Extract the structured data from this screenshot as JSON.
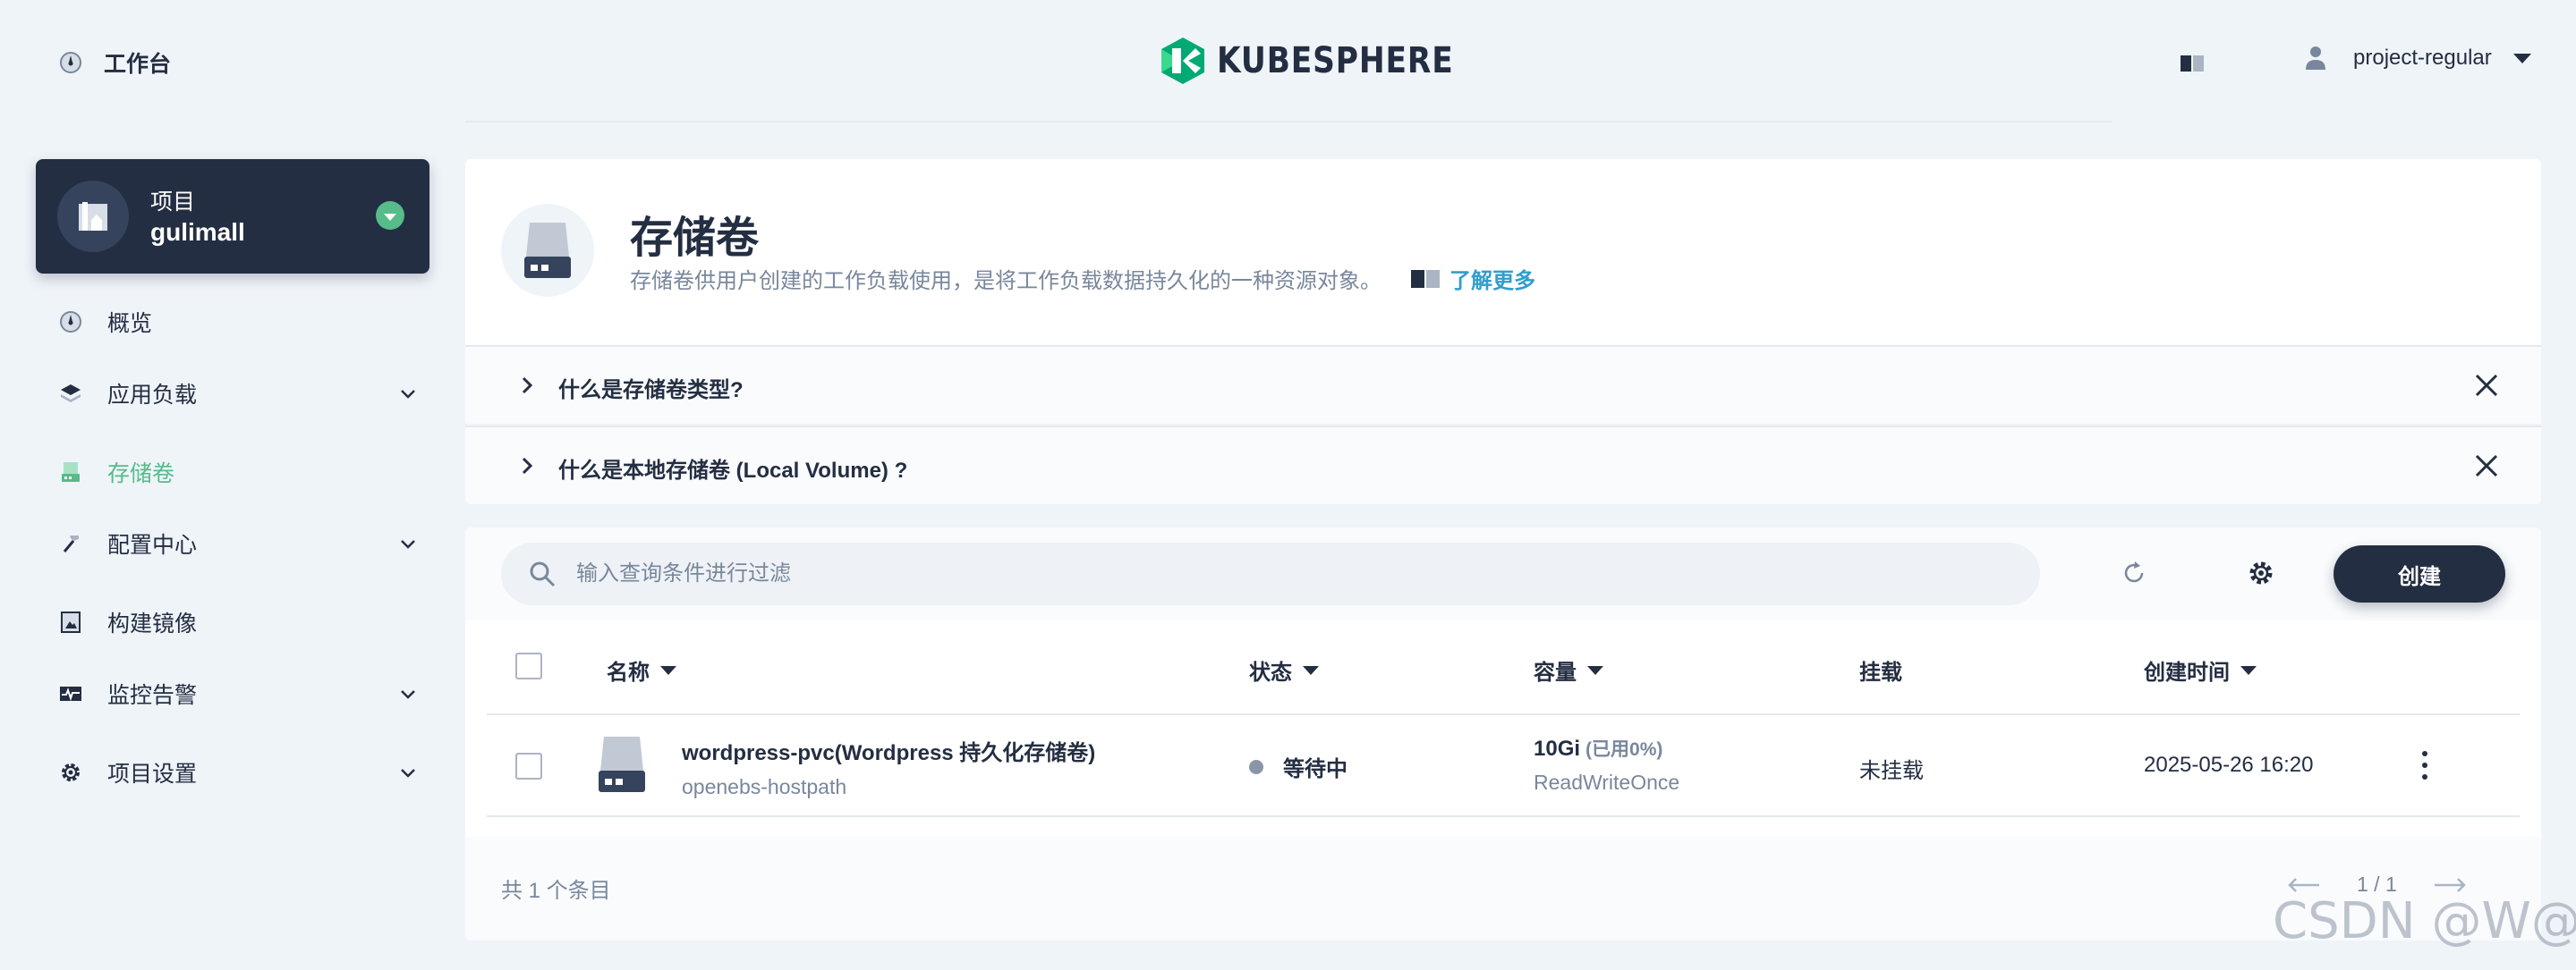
{
  "header": {
    "workbench_label": "工作台",
    "brand": "KUBESPHERE",
    "user_name": "project-regular"
  },
  "project": {
    "kind_label": "项目",
    "name": "gulimall"
  },
  "sidebar": {
    "items": [
      {
        "label": "概览",
        "icon": "dashboard-icon",
        "expandable": false,
        "active": false
      },
      {
        "label": "应用负载",
        "icon": "layers-icon",
        "expandable": true,
        "active": false
      },
      {
        "label": "存储卷",
        "icon": "storage-icon",
        "expandable": false,
        "active": true
      },
      {
        "label": "配置中心",
        "icon": "hammer-icon",
        "expandable": true,
        "active": false
      },
      {
        "label": "构建镜像",
        "icon": "image-builder-icon",
        "expandable": false,
        "active": false
      },
      {
        "label": "监控告警",
        "icon": "monitor-icon",
        "expandable": true,
        "active": false
      },
      {
        "label": "项目设置",
        "icon": "gear-icon",
        "expandable": true,
        "active": false
      }
    ]
  },
  "banner": {
    "title": "存储卷",
    "description": "存储卷供用户创建的工作负载使用，是将工作负载数据持久化的一种资源对象。",
    "learn_more": "了解更多"
  },
  "faq": [
    {
      "question": "什么是存储卷类型?"
    },
    {
      "question": "什么是本地存储卷 (Local Volume) ?"
    }
  ],
  "toolbar": {
    "search_placeholder": "输入查询条件进行过滤",
    "create_label": "创建"
  },
  "table": {
    "columns": {
      "name": "名称",
      "status": "状态",
      "capacity": "容量",
      "mount": "挂载",
      "created": "创建时间"
    },
    "rows": [
      {
        "name": "wordpress-pvc(Wordpress 持久化存储卷)",
        "storage_class": "openebs-hostpath",
        "status": "等待中",
        "capacity": "10Gi",
        "used": "(已用0%)",
        "access_mode": "ReadWriteOnce",
        "mount": "未挂载",
        "created": "2025-05-26 16:20"
      }
    ]
  },
  "footer": {
    "total": "共 1 个条目",
    "page": "1 / 1"
  },
  "watermark": "CSDN @W@#",
  "colors": {
    "accent": "#55bc8a",
    "dark": "#242e42",
    "muted": "#79879c",
    "link": "#329dce",
    "background": "#eff4f9"
  }
}
